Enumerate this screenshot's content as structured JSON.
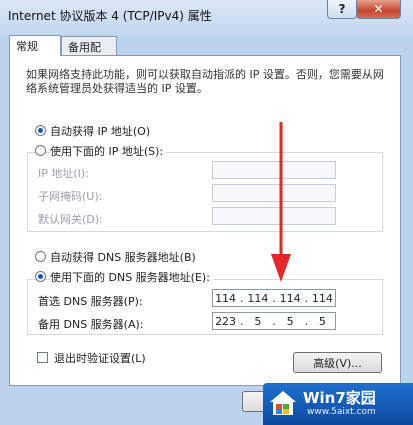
{
  "window": {
    "title": "Internet 协议版本 4 (TCP/IPv4) 属性",
    "help_label": "?",
    "close_label": "✕"
  },
  "tabs": [
    {
      "label": "常规"
    },
    {
      "label": "备用配置"
    }
  ],
  "description": "如果网络支持此功能，则可以获取自动指派的 IP 设置。否则，您需要从网络系统管理员处获得适当的 IP 设置。",
  "ip": {
    "auto_label": "自动获得 IP 地址(O)",
    "manual_label": "使用下面的 IP 地址(S):",
    "address_label": "IP 地址(I):",
    "subnet_label": "子网掩码(U):",
    "gateway_label": "默认网关(D):"
  },
  "dns": {
    "auto_label": "自动获得 DNS 服务器地址(B)",
    "manual_label": "使用下面的 DNS 服务器地址(E):",
    "preferred_label": "首选 DNS 服务器(P):",
    "preferred_value": [
      "114",
      "114",
      "114",
      "114"
    ],
    "alternate_label": "备用 DNS 服务器(A):",
    "alternate_value": [
      "223",
      "5",
      "5",
      "5"
    ]
  },
  "validate_label": "退出时验证设置(L)",
  "advanced_label": "高级(V)...",
  "watermark": {
    "title": "Win7家园",
    "url": "www.5aixt.com"
  },
  "colors": {
    "arrow": "#e2262a",
    "accent": "#1a56b8"
  }
}
